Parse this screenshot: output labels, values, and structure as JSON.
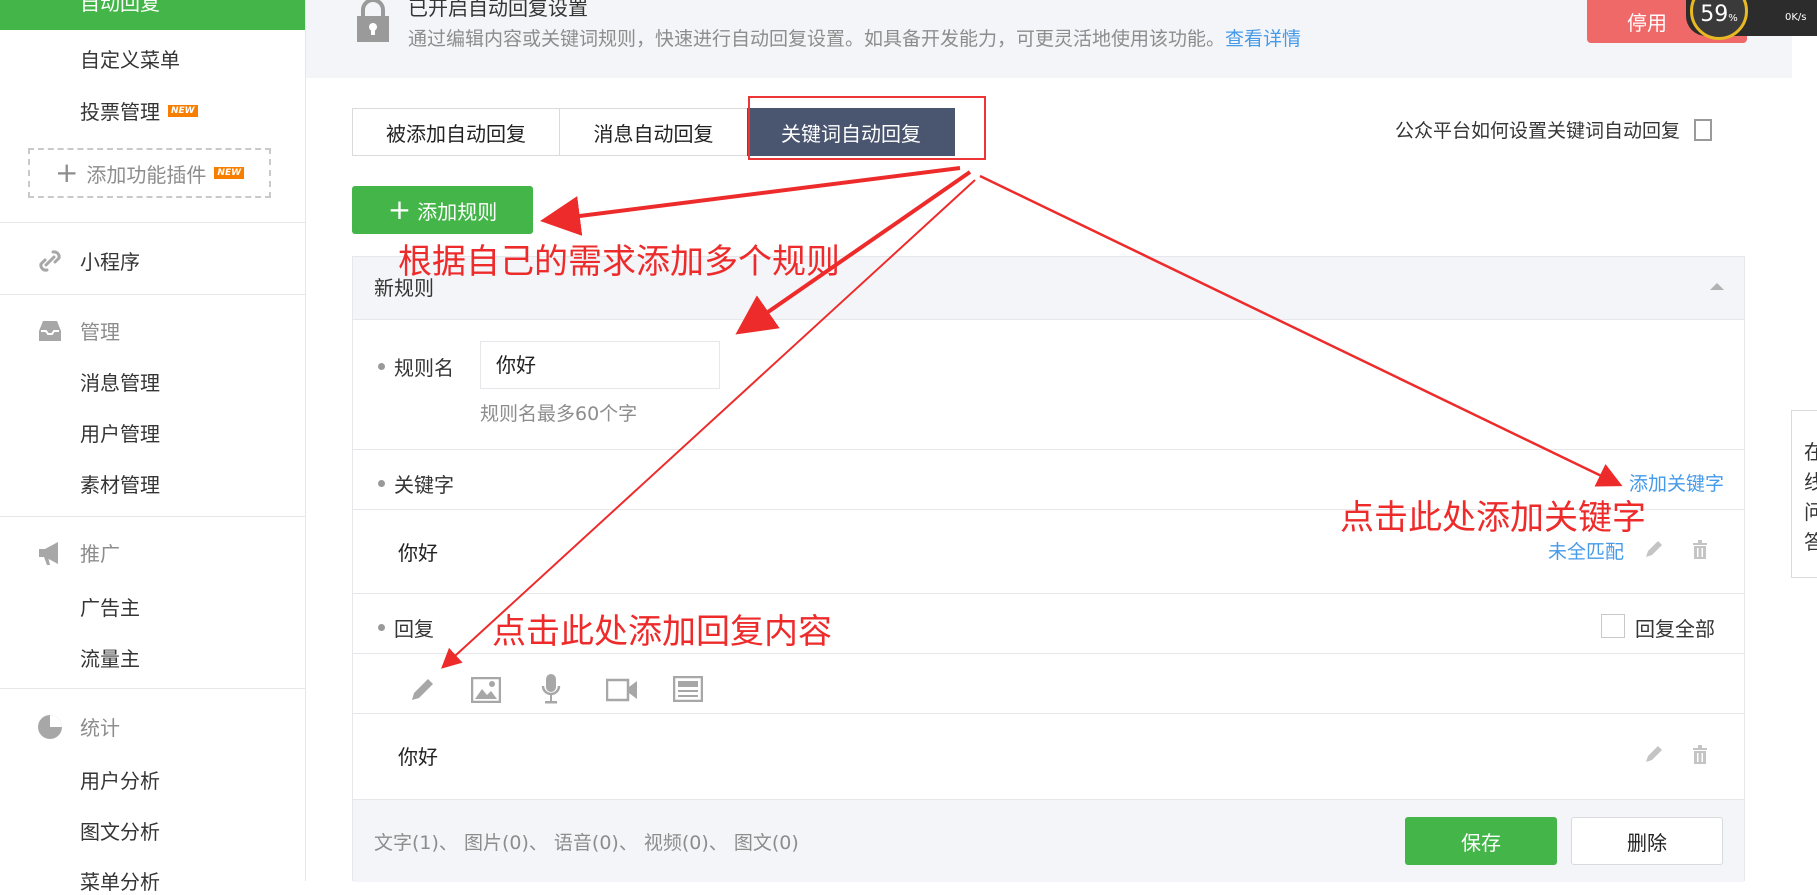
{
  "sidebar": {
    "active_item": "自动回复",
    "items": [
      "自定义菜单",
      "投票管理"
    ],
    "new_badge": "NEW",
    "add_plugin": "添加功能插件",
    "mini_program": "小程序",
    "manage": {
      "title": "管理",
      "items": [
        "消息管理",
        "用户管理",
        "素材管理"
      ]
    },
    "promote": {
      "title": "推广",
      "items": [
        "广告主",
        "流量主"
      ]
    },
    "stats": {
      "title": "统计",
      "items": [
        "用户分析",
        "图文分析",
        "菜单分析"
      ]
    }
  },
  "banner": {
    "title": "已开启自动回复设置",
    "description": "通过编辑内容或关键词规则，快速进行自动回复设置。如具备开发能力，可更灵活地使用该功能。",
    "detail_link": "查看详情",
    "stop_button": "停用",
    "speed_percent": "59",
    "speed_percent_sign": "%",
    "speed_rate": "0K/s"
  },
  "tabs": [
    "被添加自动回复",
    "消息自动回复",
    "关键词自动回复"
  ],
  "help_link": "公众平台如何设置关键词自动回复",
  "add_rule_button": "添加规则",
  "rule": {
    "header": "新规则",
    "name_label": "规则名",
    "name_value": "你好",
    "name_hint": "规则名最多60个字",
    "keyword_label": "关键字",
    "add_keyword": "添加关键字",
    "keyword_value": "你好",
    "match_mode": "未全匹配",
    "reply_label": "回复",
    "reply_all": "回复全部",
    "reply_value": "你好",
    "counts": "文字(1)、 图片(0)、 语音(0)、 视频(0)、 图文(0)",
    "save": "保存",
    "delete": "删除"
  },
  "annotations": {
    "add_rules": "根据自己的需求添加多个规则",
    "add_keyword": "点击此处添加关键字",
    "add_reply": "点击此处添加回复内容"
  },
  "right_edge_text": "在线问答",
  "colors": {
    "green": "#44b549",
    "tab_active": "#4a5670",
    "link": "#459ae9",
    "annotation": "#ee2b2b"
  }
}
